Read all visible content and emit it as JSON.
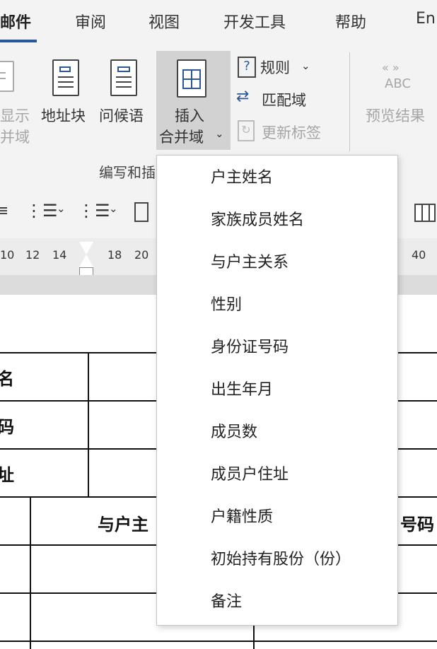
{
  "tabs": {
    "mailings": "邮件",
    "review": "审阅",
    "view": "视图",
    "developer": "开发工具",
    "help": "帮助",
    "english": "En"
  },
  "ribbon": {
    "highlight_line1": "显示",
    "highlight_line2": "并域",
    "address_block": "地址块",
    "greeting_line": "问候语",
    "insert_line1": "插入",
    "insert_line2": "合并域",
    "rules": "规则",
    "match_fields": "匹配域",
    "update_labels": "更新标签",
    "preview_icon_text": "ABC",
    "preview_results": "预览结果",
    "group_label": "编写和插"
  },
  "ruler": {
    "ticks": [
      "10",
      "12",
      "14",
      "18",
      "20",
      "40"
    ]
  },
  "document": {
    "row1": "名",
    "row2": "码",
    "row3": "址",
    "header_left": "",
    "header_mid": "与户主",
    "header_right": "号码"
  },
  "menu": {
    "items": [
      "户主姓名",
      "家族成员姓名",
      "与户主关系",
      "性别",
      "身份证号码",
      "出生年月",
      "成员数",
      "成员户住址",
      "户籍性质",
      "初始持有股份（份）",
      "备注"
    ]
  }
}
